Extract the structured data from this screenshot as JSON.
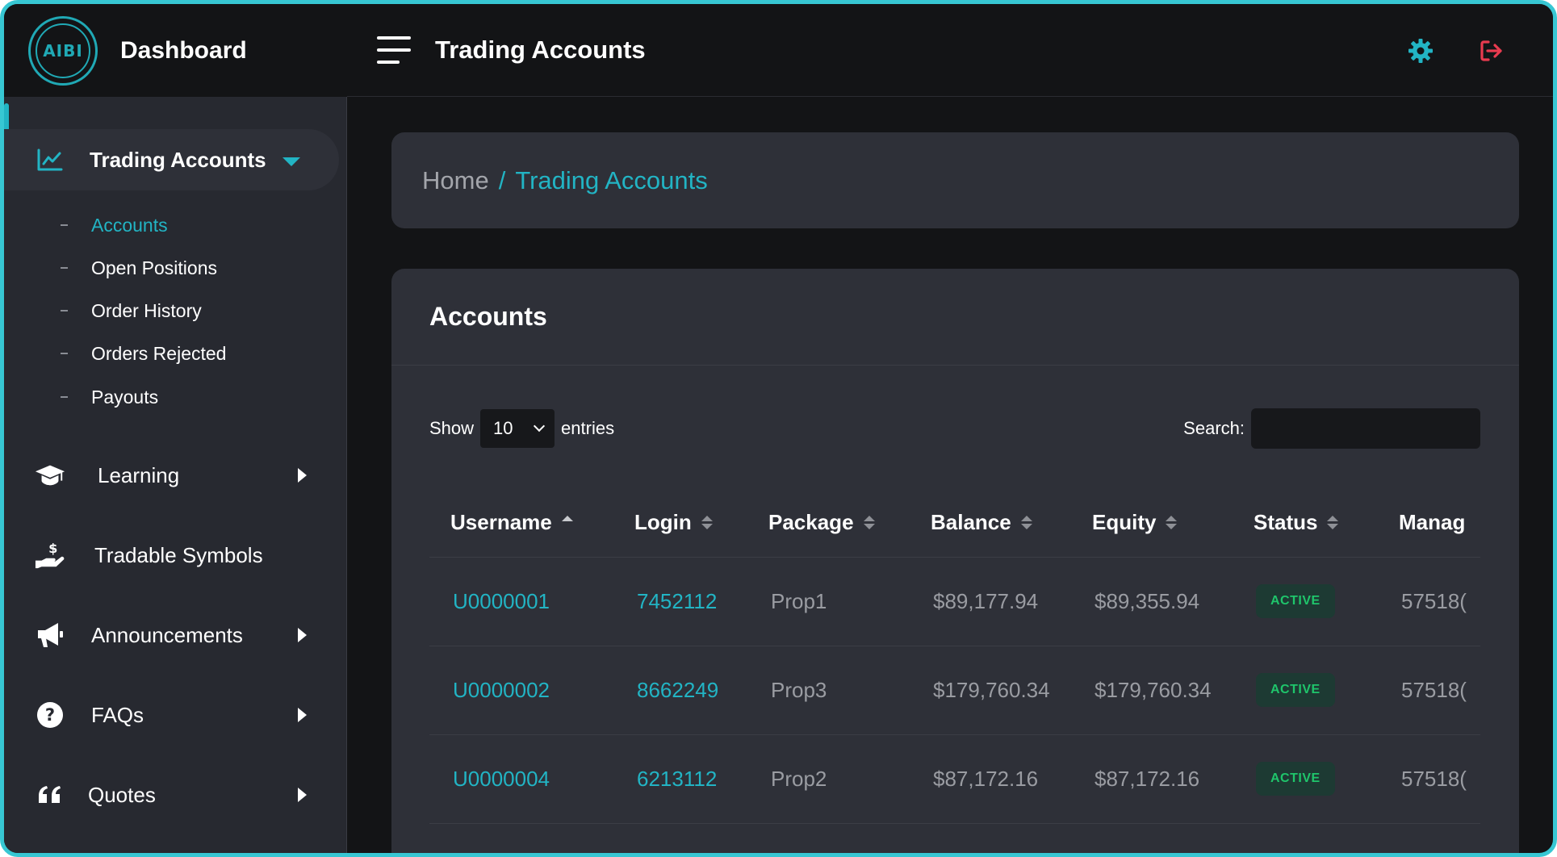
{
  "brand": {
    "logo_text": "AIBI",
    "title": "Dashboard"
  },
  "topbar": {
    "title": "Trading Accounts",
    "settings_icon": "gear-icon",
    "logout_icon": "logout-icon",
    "icon_color_settings": "#22b4c4",
    "icon_color_logout": "#e83b4f"
  },
  "sidebar": {
    "accent": "#22b4c4",
    "items": [
      {
        "label": "Trading Accounts",
        "icon": "chart-line-icon",
        "expanded": true
      },
      {
        "label": "Learning",
        "icon": "graduation-cap-icon"
      },
      {
        "label": "Tradable Symbols",
        "icon": "hand-dollar-icon"
      },
      {
        "label": "Announcements",
        "icon": "megaphone-icon"
      },
      {
        "label": "FAQs",
        "icon": "question-circle-icon"
      },
      {
        "label": "Quotes",
        "icon": "quote-icon"
      }
    ],
    "subitems": [
      {
        "label": "Accounts",
        "current": true
      },
      {
        "label": "Open Positions"
      },
      {
        "label": "Order History"
      },
      {
        "label": "Orders Rejected"
      },
      {
        "label": "Payouts"
      }
    ]
  },
  "breadcrumb": {
    "home": "Home",
    "separator": "/",
    "current": "Trading Accounts"
  },
  "card": {
    "title": "Accounts"
  },
  "controls": {
    "show_label": "Show",
    "entries_value": "10",
    "entries_label": "entries",
    "search_label": "Search:",
    "search_value": ""
  },
  "table": {
    "columns": [
      "Username",
      "Login",
      "Package",
      "Balance",
      "Equity",
      "Status",
      "Manag"
    ],
    "rows": [
      {
        "username": "U0000001",
        "login": "7452112",
        "package": "Prop1",
        "balance": "$89,177.94",
        "equity": "$89,355.94",
        "status": "ACTIVE",
        "manager": "57518("
      },
      {
        "username": "U0000002",
        "login": "8662249",
        "package": "Prop3",
        "balance": "$179,760.34",
        "equity": "$179,760.34",
        "status": "ACTIVE",
        "manager": "57518("
      },
      {
        "username": "U0000004",
        "login": "6213112",
        "package": "Prop2",
        "balance": "$87,172.16",
        "equity": "$87,172.16",
        "status": "ACTIVE",
        "manager": "57518("
      }
    ]
  }
}
